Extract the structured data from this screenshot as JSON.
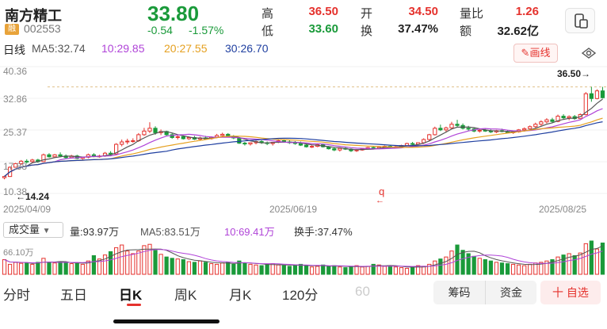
{
  "header": {
    "name": "南方精工",
    "badge": "融",
    "code": "002553",
    "price": "33.80",
    "change_abs": "-0.54",
    "change_pct": "-1.57%",
    "quotes": [
      {
        "label": "高",
        "value": "36.50",
        "color": "#e5322d"
      },
      {
        "label": "低",
        "value": "33.60",
        "color": "#1a9a3a"
      },
      {
        "label": "开",
        "value": "34.50",
        "color": "#e5322d"
      },
      {
        "label": "换",
        "value": "37.47%",
        "color": "#222222"
      },
      {
        "label": "量比",
        "value": "1.26",
        "color": "#e5322d"
      },
      {
        "label": "额",
        "value": "32.62亿",
        "color": "#222222"
      }
    ]
  },
  "ma_line": {
    "period": "日线",
    "ma5": "MA5:32.74",
    "ma10": "10:29.85",
    "ma20": "20:27.55",
    "ma30": "30:26.70",
    "draw_button": "画线"
  },
  "chart_data": {
    "type": "candlestick",
    "y_ticks": [
      "40.36",
      "32.86",
      "25.37",
      "17.88",
      "10.38"
    ],
    "x_labels": [
      "2025/04/09",
      "2025/06/19",
      "2025/08/25"
    ],
    "max_label": "36.50",
    "min_label": "14.24",
    "marker": "q",
    "ma_colors": {
      "ma5": "#555555",
      "ma10": "#b044d8",
      "ma20": "#e5a020",
      "ma30": "#1f3fa0"
    },
    "candles": [
      [
        13.9,
        14.4,
        13.5,
        14.2
      ],
      [
        14.2,
        16.7,
        14.1,
        16.5
      ],
      [
        16.5,
        17.6,
        16.4,
        17.4
      ],
      [
        17.4,
        18.3,
        17.0,
        18.0
      ],
      [
        18.0,
        18.5,
        17.4,
        17.9
      ],
      [
        17.9,
        18.6,
        17.5,
        18.3
      ],
      [
        18.3,
        18.6,
        17.6,
        17.9
      ],
      [
        17.9,
        19.9,
        17.8,
        19.6
      ],
      [
        19.6,
        20.0,
        18.9,
        19.1
      ],
      [
        19.1,
        19.8,
        18.9,
        19.6
      ],
      [
        19.6,
        20.2,
        19.0,
        19.3
      ],
      [
        19.3,
        19.7,
        18.6,
        18.9
      ],
      [
        18.9,
        19.6,
        18.7,
        19.3
      ],
      [
        19.3,
        19.6,
        18.5,
        18.7
      ],
      [
        18.7,
        19.1,
        18.4,
        19.0
      ],
      [
        19.0,
        19.9,
        18.7,
        19.6
      ],
      [
        19.6,
        20.0,
        19.0,
        19.2
      ],
      [
        19.2,
        19.6,
        18.9,
        19.3
      ],
      [
        19.3,
        20.3,
        19.1,
        20.0
      ],
      [
        20.0,
        20.5,
        19.4,
        19.8
      ],
      [
        19.8,
        22.5,
        19.6,
        22.2
      ],
      [
        22.2,
        23.4,
        21.7,
        22.8
      ],
      [
        22.8,
        23.6,
        22.2,
        23.0
      ],
      [
        23.0,
        23.7,
        22.6,
        23.1
      ],
      [
        23.1,
        25.0,
        22.8,
        24.6
      ],
      [
        24.6,
        26.3,
        24.3,
        25.5
      ],
      [
        25.5,
        27.7,
        25.0,
        26.2
      ],
      [
        26.2,
        26.7,
        24.6,
        25.1
      ],
      [
        25.1,
        25.9,
        24.5,
        25.4
      ],
      [
        25.4,
        25.6,
        24.2,
        24.6
      ],
      [
        24.6,
        25.0,
        23.6,
        23.9
      ],
      [
        23.9,
        24.5,
        23.4,
        24.1
      ],
      [
        24.1,
        24.3,
        23.4,
        23.6
      ],
      [
        23.6,
        24.2,
        23.3,
        23.9
      ],
      [
        23.9,
        24.3,
        23.3,
        23.5
      ],
      [
        23.5,
        24.1,
        23.2,
        23.8
      ],
      [
        23.8,
        24.3,
        23.3,
        23.6
      ],
      [
        23.6,
        24.2,
        23.4,
        24.0
      ],
      [
        24.0,
        24.8,
        23.8,
        24.4
      ],
      [
        24.4,
        25.1,
        24.0,
        24.7
      ],
      [
        24.7,
        25.0,
        23.9,
        24.1
      ],
      [
        24.1,
        24.5,
        23.5,
        23.8
      ],
      [
        23.8,
        23.9,
        22.3,
        22.5
      ],
      [
        22.5,
        22.8,
        21.9,
        22.3
      ],
      [
        22.3,
        22.7,
        21.9,
        22.6
      ],
      [
        22.6,
        23.1,
        22.2,
        22.9
      ],
      [
        22.9,
        23.2,
        22.3,
        22.6
      ],
      [
        22.6,
        22.9,
        22.0,
        22.4
      ],
      [
        22.4,
        22.8,
        21.9,
        22.7
      ],
      [
        22.7,
        23.4,
        22.5,
        23.1
      ],
      [
        23.1,
        23.5,
        22.6,
        22.8
      ],
      [
        22.8,
        23.2,
        22.3,
        22.6
      ],
      [
        22.6,
        23.0,
        22.1,
        22.5
      ],
      [
        22.5,
        22.9,
        21.8,
        22.0
      ],
      [
        22.0,
        22.3,
        21.4,
        21.6
      ],
      [
        21.6,
        22.0,
        21.3,
        21.7
      ],
      [
        21.7,
        22.4,
        21.5,
        22.1
      ],
      [
        22.1,
        22.4,
        21.4,
        21.6
      ],
      [
        21.6,
        21.8,
        20.9,
        21.1
      ],
      [
        21.1,
        21.5,
        20.5,
        20.8
      ],
      [
        20.8,
        21.4,
        20.4,
        21.2
      ],
      [
        21.2,
        21.6,
        20.8,
        21.0
      ],
      [
        21.0,
        21.2,
        20.3,
        20.6
      ],
      [
        20.6,
        21.0,
        20.3,
        20.8
      ],
      [
        20.8,
        21.3,
        20.6,
        21.1
      ],
      [
        21.1,
        21.6,
        20.9,
        21.4
      ],
      [
        21.4,
        21.7,
        21.0,
        21.2
      ],
      [
        21.2,
        21.6,
        21.0,
        21.5
      ],
      [
        21.5,
        21.9,
        21.3,
        21.7
      ],
      [
        21.7,
        22.0,
        21.3,
        21.5
      ],
      [
        21.5,
        21.8,
        21.2,
        21.6
      ],
      [
        21.6,
        22.1,
        21.4,
        21.9
      ],
      [
        21.9,
        22.6,
        21.7,
        22.4
      ],
      [
        22.4,
        22.8,
        22.0,
        22.2
      ],
      [
        22.2,
        22.7,
        21.9,
        22.6
      ],
      [
        22.6,
        23.7,
        22.3,
        23.4
      ],
      [
        23.4,
        24.8,
        23.1,
        24.6
      ],
      [
        24.6,
        26.6,
        24.4,
        26.2
      ],
      [
        26.2,
        27.1,
        25.5,
        25.8
      ],
      [
        25.8,
        26.6,
        25.1,
        26.3
      ],
      [
        26.3,
        27.8,
        26.0,
        27.2
      ],
      [
        27.2,
        28.3,
        26.5,
        26.9
      ],
      [
        26.9,
        27.4,
        25.9,
        26.2
      ],
      [
        26.2,
        26.8,
        25.6,
        26.0
      ],
      [
        26.0,
        26.3,
        25.2,
        25.5
      ],
      [
        25.5,
        26.0,
        25.1,
        25.7
      ],
      [
        25.7,
        26.2,
        25.3,
        25.5
      ],
      [
        25.5,
        25.9,
        25.0,
        25.3
      ],
      [
        25.3,
        25.8,
        25.0,
        25.6
      ],
      [
        25.6,
        26.1,
        25.2,
        25.4
      ],
      [
        25.4,
        25.7,
        24.9,
        25.1
      ],
      [
        25.1,
        25.5,
        24.8,
        25.3
      ],
      [
        25.3,
        26.0,
        25.1,
        25.8
      ],
      [
        25.8,
        26.4,
        25.4,
        26.1
      ],
      [
        26.1,
        26.9,
        25.9,
        26.6
      ],
      [
        26.6,
        27.6,
        26.3,
        27.2
      ],
      [
        27.2,
        28.2,
        26.8,
        27.8
      ],
      [
        27.8,
        28.7,
        27.4,
        28.3
      ],
      [
        28.3,
        28.8,
        27.5,
        27.9
      ],
      [
        27.9,
        29.6,
        27.7,
        29.2
      ],
      [
        29.2,
        29.7,
        28.4,
        28.8
      ],
      [
        28.8,
        29.4,
        28.2,
        29.1
      ],
      [
        29.1,
        29.5,
        28.3,
        28.6
      ],
      [
        28.6,
        29.9,
        28.5,
        29.6
      ],
      [
        29.6,
        35.2,
        29.4,
        34.8
      ],
      [
        34.8,
        36.5,
        32.8,
        33.6
      ],
      [
        33.6,
        35.9,
        33.4,
        35.5
      ],
      [
        35.5,
        36.5,
        33.6,
        33.8
      ]
    ]
  },
  "volume": {
    "selector": "成交量",
    "vol": "量:93.97万",
    "ma5": "MA5:83.51万",
    "ma10": "10:69.41万",
    "turnover": "换手:37.47%",
    "axis_label": "66.10万",
    "bars": [
      44,
      30,
      36,
      33,
      34,
      30,
      36,
      48,
      36,
      34,
      38,
      34,
      32,
      34,
      30,
      40,
      56,
      46,
      58,
      68,
      80,
      88,
      70,
      62,
      70,
      86,
      90,
      72,
      60,
      52,
      48,
      46,
      44,
      38,
      36,
      40,
      36,
      32,
      30,
      34,
      36,
      30,
      40,
      34,
      30,
      28,
      26,
      30,
      32,
      28,
      26,
      24,
      28,
      30,
      26,
      22,
      24,
      28,
      24,
      26,
      22,
      20,
      24,
      26,
      22,
      24,
      30,
      28,
      24,
      26,
      22,
      20,
      18,
      22,
      26,
      24,
      30,
      40,
      46,
      52,
      70,
      88,
      72,
      62,
      54,
      48,
      44,
      40,
      36,
      34,
      32,
      30,
      28,
      26,
      30,
      34,
      36,
      40,
      44,
      52,
      58,
      62,
      56,
      64,
      92,
      100,
      76,
      94
    ]
  },
  "tabs": [
    "分时",
    "五日",
    "日K",
    "周K",
    "月K",
    "120分",
    "60"
  ],
  "active_tab": "日K",
  "actions": {
    "chips": "筹码",
    "funds": "资金",
    "watch": "十 自选"
  }
}
